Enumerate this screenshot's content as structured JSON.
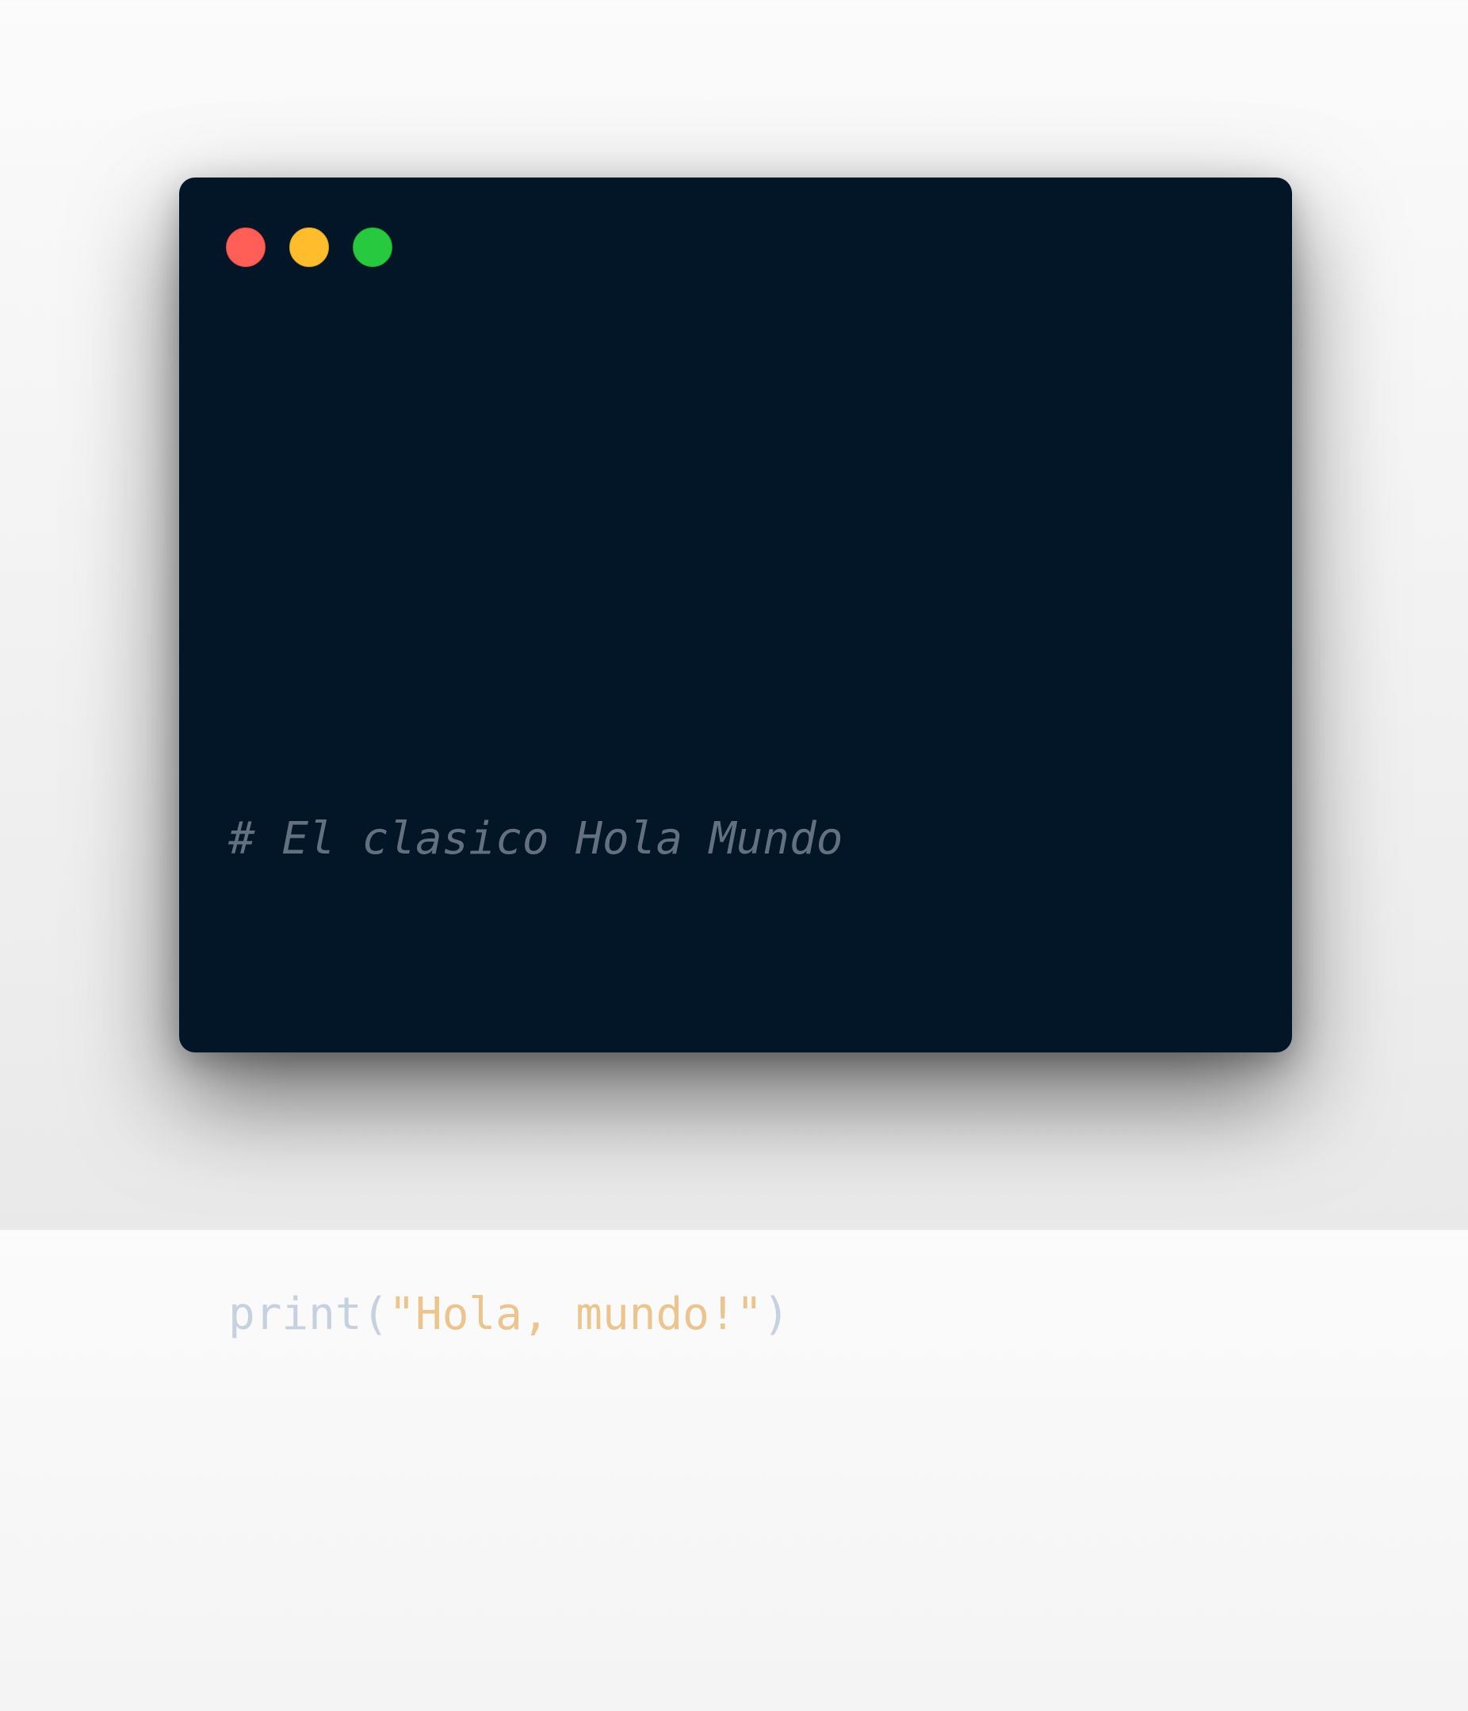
{
  "window": {
    "background_color": "#021627",
    "traffic_lights": [
      {
        "name": "close",
        "color": "#ff5f56"
      },
      {
        "name": "minimize",
        "color": "#ffbd2e"
      },
      {
        "name": "maximize",
        "color": "#27c93f"
      }
    ]
  },
  "code": {
    "language": "python",
    "lines": [
      {
        "comment": "# El clasico Hola Mundo"
      },
      {
        "function": "print",
        "open_paren": "(",
        "string": "\"Hola, mundo!\"",
        "close_paren": ")"
      }
    ],
    "colors": {
      "comment": "#637081",
      "function": "#c6d1df",
      "string": "#ecc48d"
    }
  }
}
